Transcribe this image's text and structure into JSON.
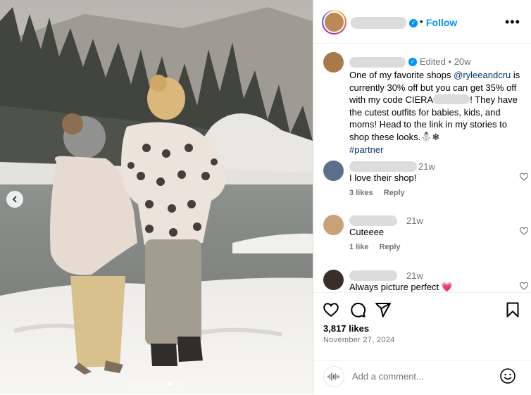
{
  "post": {
    "header": {
      "follow_label": "Follow",
      "separator": "•",
      "more_label": "•••"
    },
    "caption": {
      "edited_label": "Edited",
      "time_sep": "•",
      "time": "20w",
      "text_a": "One of my favorite shops ",
      "mention": "@ryleeandcru",
      "text_b": " is currently 30% off but you can get 35% off with my code CIERA",
      "text_c": "! They have the cutest outfits for babies, kids, and moms! Head to the link in my stories to shop these looks.",
      "emoji": "⛄❄",
      "hashtag": "#partner"
    },
    "comments": [
      {
        "time": "21w",
        "text": "I love their shop!",
        "likes_label": "3 likes",
        "reply_label": "Reply"
      },
      {
        "time": "21w",
        "text": "Cuteeee",
        "likes_label": "1 like",
        "reply_label": "Reply"
      },
      {
        "time": "21w",
        "text": "Always picture perfect 💗"
      }
    ],
    "likes": "3,817 likes",
    "date": "November 27, 2024",
    "add_comment_placeholder": "Add a comment...",
    "carousel": {
      "slide_count": 7,
      "active_index": 5
    }
  },
  "colors": {
    "accent": "#0095f6",
    "mention": "#00376b",
    "muted": "#737373"
  },
  "icons": [
    "chevron-left-icon",
    "verified-icon",
    "more-icon",
    "heart-icon",
    "comment-icon",
    "share-icon",
    "bookmark-icon",
    "emoji-icon"
  ]
}
